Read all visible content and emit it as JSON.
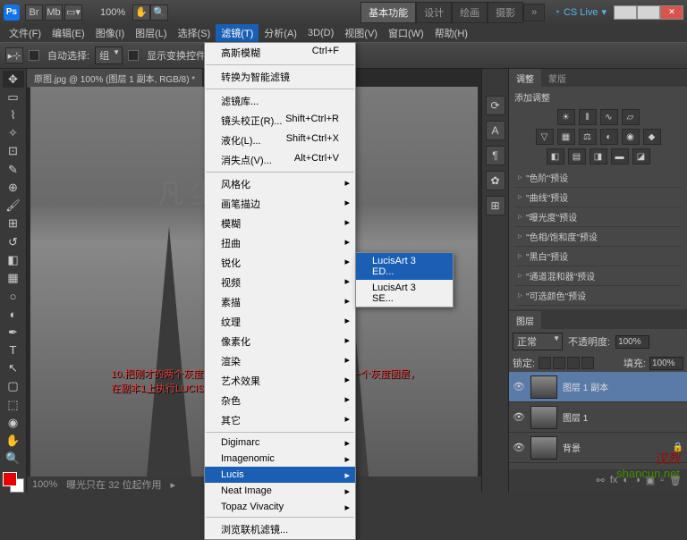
{
  "titlebar": {
    "zoom": "100%"
  },
  "workspace_tabs": [
    "基本功能",
    "设计",
    "绘画",
    "摄影"
  ],
  "cslive": "CS Live",
  "menubar": [
    "文件(F)",
    "编辑(E)",
    "图像(I)",
    "图层(L)",
    "选择(S)",
    "滤镜(T)",
    "分析(A)",
    "3D(D)",
    "视图(V)",
    "窗口(W)",
    "帮助(H)"
  ],
  "optbar": {
    "auto_select": "自动选择:",
    "group": "组",
    "show_transform": "显示变换控件"
  },
  "doc_tab": "原图.jpg @ 100% (图层 1 副本, RGB/8) *",
  "watermark": "凡尘觉醒教程",
  "red_text_1": "10.把刚才的两个灰度图层合并在一起，然后再次复制出一个灰度图层，",
  "red_text_2": "在副本1上执行LUCISART。",
  "filter_menu": [
    {
      "label": "高斯模糊",
      "shortcut": "Ctrl+F"
    },
    {
      "sep": true
    },
    {
      "label": "转换为智能滤镜"
    },
    {
      "sep": true
    },
    {
      "label": "滤镜库..."
    },
    {
      "label": "镜头校正(R)...",
      "shortcut": "Shift+Ctrl+R"
    },
    {
      "label": "液化(L)...",
      "shortcut": "Shift+Ctrl+X"
    },
    {
      "label": "消失点(V)...",
      "shortcut": "Alt+Ctrl+V"
    },
    {
      "sep": true
    },
    {
      "label": "风格化",
      "sub": true
    },
    {
      "label": "画笔描边",
      "sub": true
    },
    {
      "label": "模糊",
      "sub": true
    },
    {
      "label": "扭曲",
      "sub": true
    },
    {
      "label": "锐化",
      "sub": true
    },
    {
      "label": "视频",
      "sub": true
    },
    {
      "label": "素描",
      "sub": true
    },
    {
      "label": "纹理",
      "sub": true
    },
    {
      "label": "像素化",
      "sub": true
    },
    {
      "label": "渲染",
      "sub": true
    },
    {
      "label": "艺术效果",
      "sub": true
    },
    {
      "label": "杂色",
      "sub": true
    },
    {
      "label": "其它",
      "sub": true
    },
    {
      "sep": true
    },
    {
      "label": "Digimarc",
      "sub": true
    },
    {
      "label": "Imagenomic",
      "sub": true
    },
    {
      "label": "Lucis",
      "sub": true,
      "highlight": true
    },
    {
      "label": "Neat Image",
      "sub": true
    },
    {
      "label": "Topaz Vivacity",
      "sub": true
    },
    {
      "sep": true
    },
    {
      "label": "浏览联机滤镜..."
    }
  ],
  "lucis_submenu": [
    "LucisArt 3 ED...",
    "LucisArt 3 SE..."
  ],
  "adjustments": {
    "tab1": "调整",
    "tab2": "蒙版",
    "title": "添加调整",
    "presets": [
      "\"色阶\"预设",
      "\"曲线\"预设",
      "\"曝光度\"预设",
      "\"色相/饱和度\"预设",
      "\"黑白\"预设",
      "\"通道混和器\"预设",
      "\"可选颜色\"预设"
    ]
  },
  "layers": {
    "tab": "图层",
    "blend": "正常",
    "opacity_label": "不透明度:",
    "opacity": "100%",
    "lock_label": "锁定:",
    "fill_label": "填充:",
    "fill": "100%",
    "items": [
      {
        "name": "图层 1 副本",
        "active": true
      },
      {
        "name": "图层 1"
      },
      {
        "name": "背景",
        "locked": true
      }
    ]
  },
  "status": {
    "zoom": "100%",
    "info": "曝光只在 32 位起作用"
  },
  "site_wm": "汉烈",
  "site_url": "shancun.net"
}
